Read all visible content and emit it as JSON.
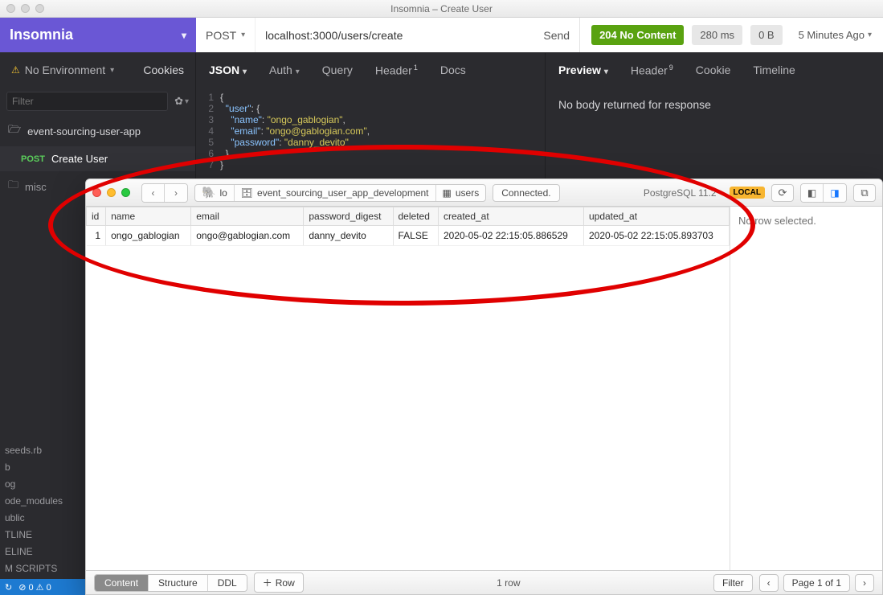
{
  "mac_titlebar": {
    "title": "Insomnia – Create User"
  },
  "brand": {
    "name": "Insomnia"
  },
  "request_bar": {
    "method": "POST",
    "url": "localhost:3000/users/create",
    "send_label": "Send"
  },
  "response_bar": {
    "status": "204 No Content",
    "time": "280 ms",
    "size": "0 B",
    "ago": "5 Minutes Ago"
  },
  "env_bar": {
    "no_env": "No Environment",
    "cookies": "Cookies"
  },
  "request_tabs": {
    "body": "JSON",
    "auth": "Auth",
    "query": "Query",
    "header": "Header",
    "header_badge": "1",
    "docs": "Docs"
  },
  "response_tabs": {
    "preview": "Preview",
    "header": "Header",
    "header_badge": "9",
    "cookie": "Cookie",
    "timeline": "Timeline"
  },
  "sidebar": {
    "filter_placeholder": "Filter",
    "folder": "event-sourcing-user-app",
    "request_method": "POST",
    "request_name": "Create User",
    "misc": "misc",
    "bottom_lines": [
      "seeds.rb",
      "b",
      "og",
      "ode_modules",
      "ublic",
      "TLINE",
      "ELINE",
      "M SCRIPTS"
    ]
  },
  "editor_json": {
    "user_key": "user",
    "name_key": "name",
    "name_val": "ongo_gablogian",
    "email_key": "email",
    "email_val": "ongo@gablogian.com",
    "password_key": "password",
    "password_val": "danny_devito"
  },
  "response_body": {
    "message": "No body returned for response"
  },
  "vscode_status": {
    "text": "⊘ 0  ⚠ 0"
  },
  "db_window": {
    "breadcrumb_host": "lo",
    "breadcrumb_db": "event_sourcing_user_app_development",
    "breadcrumb_table": "users",
    "conn_status": "Connected.",
    "engine": "PostgreSQL 11.2",
    "local_badge": "LOCAL",
    "columns": [
      "id",
      "name",
      "email",
      "password_digest",
      "deleted",
      "created_at",
      "updated_at"
    ],
    "rows": [
      {
        "id": "1",
        "name": "ongo_gablogian",
        "email": "ongo@gablogian.com",
        "password_digest": "danny_devito",
        "deleted": "FALSE",
        "created_at": "2020-05-02 22:15:05.886529",
        "updated_at": "2020-05-02 22:15:05.893703"
      }
    ],
    "side_message": "No row selected.",
    "bottom_tabs": {
      "content": "Content",
      "structure": "Structure",
      "ddl": "DDL"
    },
    "add_row": "Row",
    "row_count": "1 row",
    "filter": "Filter",
    "page_label": "Page 1 of 1"
  }
}
